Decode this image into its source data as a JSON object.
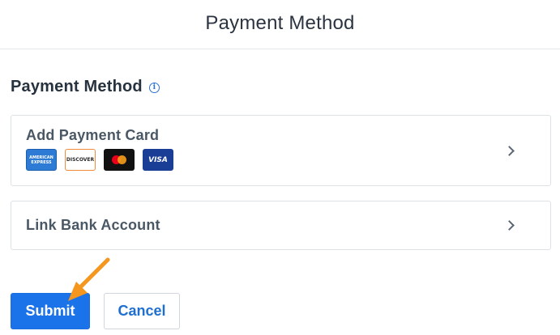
{
  "header": {
    "title": "Payment Method"
  },
  "section": {
    "title": "Payment Method",
    "info_icon": "info-circle-icon"
  },
  "options": {
    "card": {
      "label": "Add Payment Card",
      "chevron_icon": "chevron-right-icon"
    },
    "bank": {
      "label": "Link Bank Account",
      "chevron_icon": "chevron-right-icon"
    }
  },
  "card_logos": {
    "amex": [
      "AMERICAN",
      "EXPRESS"
    ],
    "discover": "DISCOVER",
    "visa": "VISA"
  },
  "buttons": {
    "submit": "Submit",
    "cancel": "Cancel"
  },
  "colors": {
    "accent": "#1a73e8",
    "pointer_arrow": "#f5961f"
  }
}
